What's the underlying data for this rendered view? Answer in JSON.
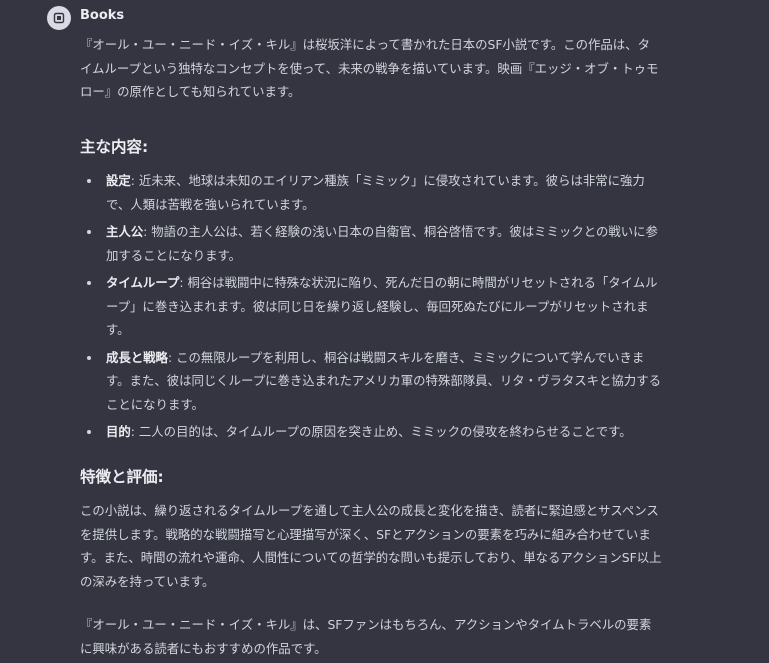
{
  "header": {
    "sender": "Books",
    "avatar_icon": "book-icon"
  },
  "intro": "『オール・ユー・ニード・イズ・キル』は桜坂洋によって書かれた日本のSF小説です。この作品は、タイムループという独特なコンセプトを使って、未来の戦争を描いています。映画『エッジ・オブ・トゥモロー』の原作としても知られています。",
  "main_content": {
    "heading": "主な内容:",
    "items": [
      {
        "term": "設定",
        "text": ": 近未来、地球は未知のエイリアン種族「ミミック」に侵攻されています。彼らは非常に強力で、人類は苦戦を強いられています。"
      },
      {
        "term": "主人公",
        "text": ": 物語の主人公は、若く経験の浅い日本の自衛官、桐谷啓悟です。彼はミミックとの戦いに参加することになります。"
      },
      {
        "term": "タイムループ",
        "text": ": 桐谷は戦闘中に特殊な状況に陥り、死んだ日の朝に時間がリセットされる「タイムループ」に巻き込まれます。彼は同じ日を繰り返し経験し、毎回死ぬたびにループがリセットされます。"
      },
      {
        "term": "成長と戦略",
        "text": ": この無限ループを利用し、桐谷は戦闘スキルを磨き、ミミックについて学んでいきます。また、彼は同じくループに巻き込まれたアメリカ軍の特殊部隊員、リタ・ヴラタスキと協力することになります。"
      },
      {
        "term": "目的",
        "text": ": 二人の目的は、タイムループの原因を突き止め、ミミックの侵攻を終わらせることです。"
      }
    ]
  },
  "features": {
    "heading": "特徴と評価:",
    "paragraph": "この小説は、繰り返されるタイムループを通して主人公の成長と変化を描き、読者に緊迫感とサスペンスを提供します。戦略的な戦闘描写と心理描写が深く、SFとアクションの要素を巧みに組み合わせています。また、時間の流れや運命、人間性についての哲学的な問いも提示しており、単なるアクションSF以上の深みを持っています。"
  },
  "closing": "『オール・ユー・ニード・イズ・キル』は、SFファンはもちろん、アクションやタイムトラベルの要素に興味がある読者にもおすすめの作品です。",
  "colors": {
    "background": "#343541",
    "text": "#d1d5db",
    "heading": "#ececf1",
    "avatar_bg": "#d9d9e3"
  }
}
